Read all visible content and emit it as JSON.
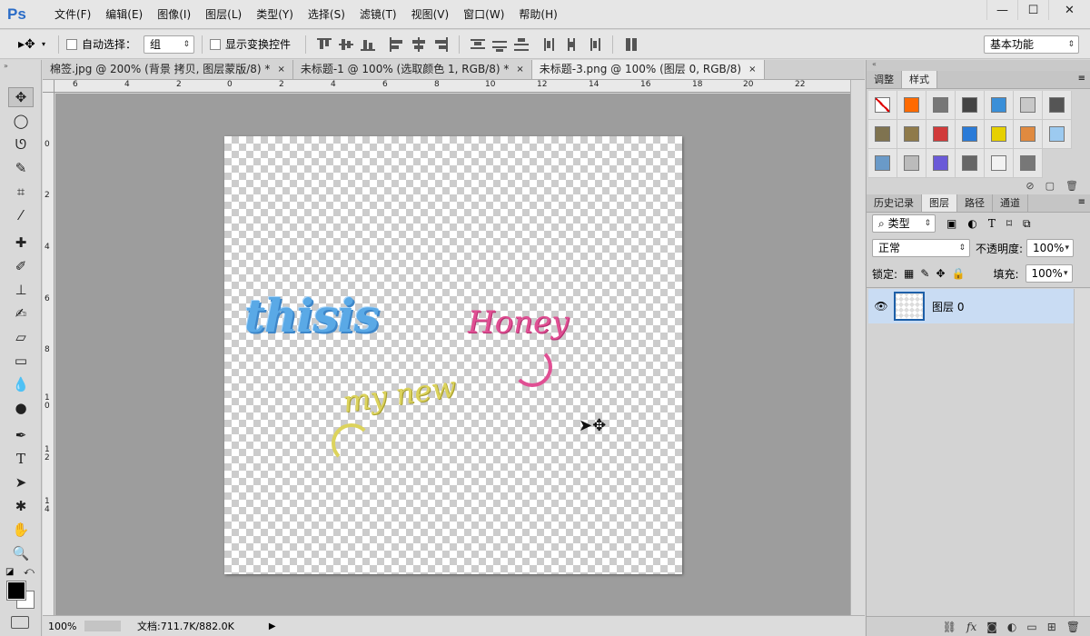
{
  "app": {
    "logo": "Ps"
  },
  "menu": [
    "文件(F)",
    "编辑(E)",
    "图像(I)",
    "图层(L)",
    "类型(Y)",
    "选择(S)",
    "滤镜(T)",
    "视图(V)",
    "窗口(W)",
    "帮助(H)"
  ],
  "window_controls": {
    "minimize": "—",
    "maximize": "☐",
    "close": "✕"
  },
  "options": {
    "auto_select_label": "自动选择：",
    "auto_select_value": "组",
    "show_transform_label": "显示变换控件",
    "workspace": "基本功能"
  },
  "tabs": [
    {
      "label": "棉签.jpg @ 200% (背景 拷贝, 图层蒙版/8) *",
      "close": "×"
    },
    {
      "label": "未标题-1 @ 100% (选取颜色 1, RGB/8) *",
      "close": "×"
    },
    {
      "label": "未标题-3.png @ 100% (图层 0, RGB/8)",
      "close": "×"
    }
  ],
  "ruler_h": [
    "6",
    "4",
    "2",
    "0",
    "2",
    "4",
    "6",
    "8",
    "10",
    "12",
    "14",
    "16",
    "18",
    "20",
    "22"
  ],
  "ruler_v": [
    "0",
    "2",
    "4",
    "6",
    "8",
    "1 0",
    "1 2",
    "1 4"
  ],
  "artwork": {
    "text1": "thisis",
    "text1_color": "#5aa9e6",
    "text2": "Honey",
    "text2_color": "#e04f93",
    "text3": "my new",
    "text3_color": "#dcd35c"
  },
  "status": {
    "zoom": "100%",
    "doc_info": "文档:711.7K/882.0K"
  },
  "panel_top": {
    "tabs": [
      "调整",
      "样式"
    ],
    "active": "样式"
  },
  "styles_swatches": [
    "#ffffff",
    "#ff6a00",
    "#777777",
    "#444444",
    "#3a8fd8",
    "#c8c8c8",
    "#555555",
    "#7f7350",
    "#8f7a4a",
    "#d13a3a",
    "#2a7bd8",
    "#e6d000",
    "#e08a40",
    "#9ccaf0",
    "#6a9ac8",
    "#bbbbbb",
    "#6a5ad8",
    "#666666",
    "#f2f2f2",
    "#777777"
  ],
  "panel_layers": {
    "tabs": [
      "历史记录",
      "图层",
      "路径",
      "通道"
    ],
    "active": "图层",
    "filter_kind": "类型",
    "blend_mode": "正常",
    "opacity_label": "不透明度:",
    "opacity": "100%",
    "lock_label": "锁定:",
    "fill_label": "填充:",
    "fill": "100%",
    "layer_name": "图层 0"
  }
}
